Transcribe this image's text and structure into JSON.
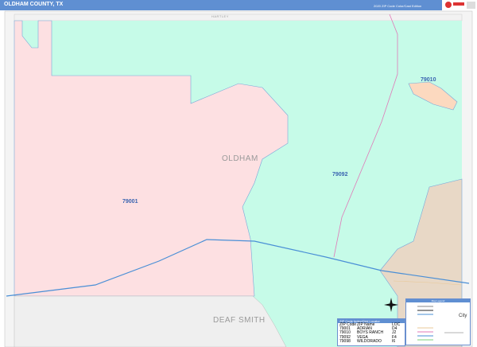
{
  "header": {
    "title": "OLDHAM COUNTY, TX",
    "subtitle": "2020 ZIP Code Color/Cast Edition"
  },
  "labels": {
    "county": "OLDHAM",
    "neighbor_north": "HARTLEY",
    "neighbor_south": "DEAF SMITH"
  },
  "zips": [
    {
      "code": "79001"
    },
    {
      "code": "79010"
    },
    {
      "code": "79092"
    }
  ],
  "zip_table": {
    "title": "ZIP Code Index/Grid Locator",
    "headers": [
      "ZIP Code",
      "ZIP Name",
      "LOC"
    ],
    "rows": [
      [
        "79001",
        "ADRIAN",
        "D4"
      ],
      [
        "79010",
        "BOYS RANCH",
        "J2"
      ],
      [
        "79092",
        "VEGA",
        "F4"
      ],
      [
        "79098",
        "WILDORADO",
        "I6"
      ]
    ]
  },
  "legend": {
    "title": "Map Legend"
  },
  "colors": {
    "header": "#5f8fd2",
    "zip_79001": "#fde0e2",
    "zip_79092": "#c6fbe8",
    "zip_79010": "#fcd9bf",
    "tan": "#e8d8c6",
    "neighbor": "#efefef",
    "highway": "#4a8fd6",
    "road": "#e07ab8"
  }
}
